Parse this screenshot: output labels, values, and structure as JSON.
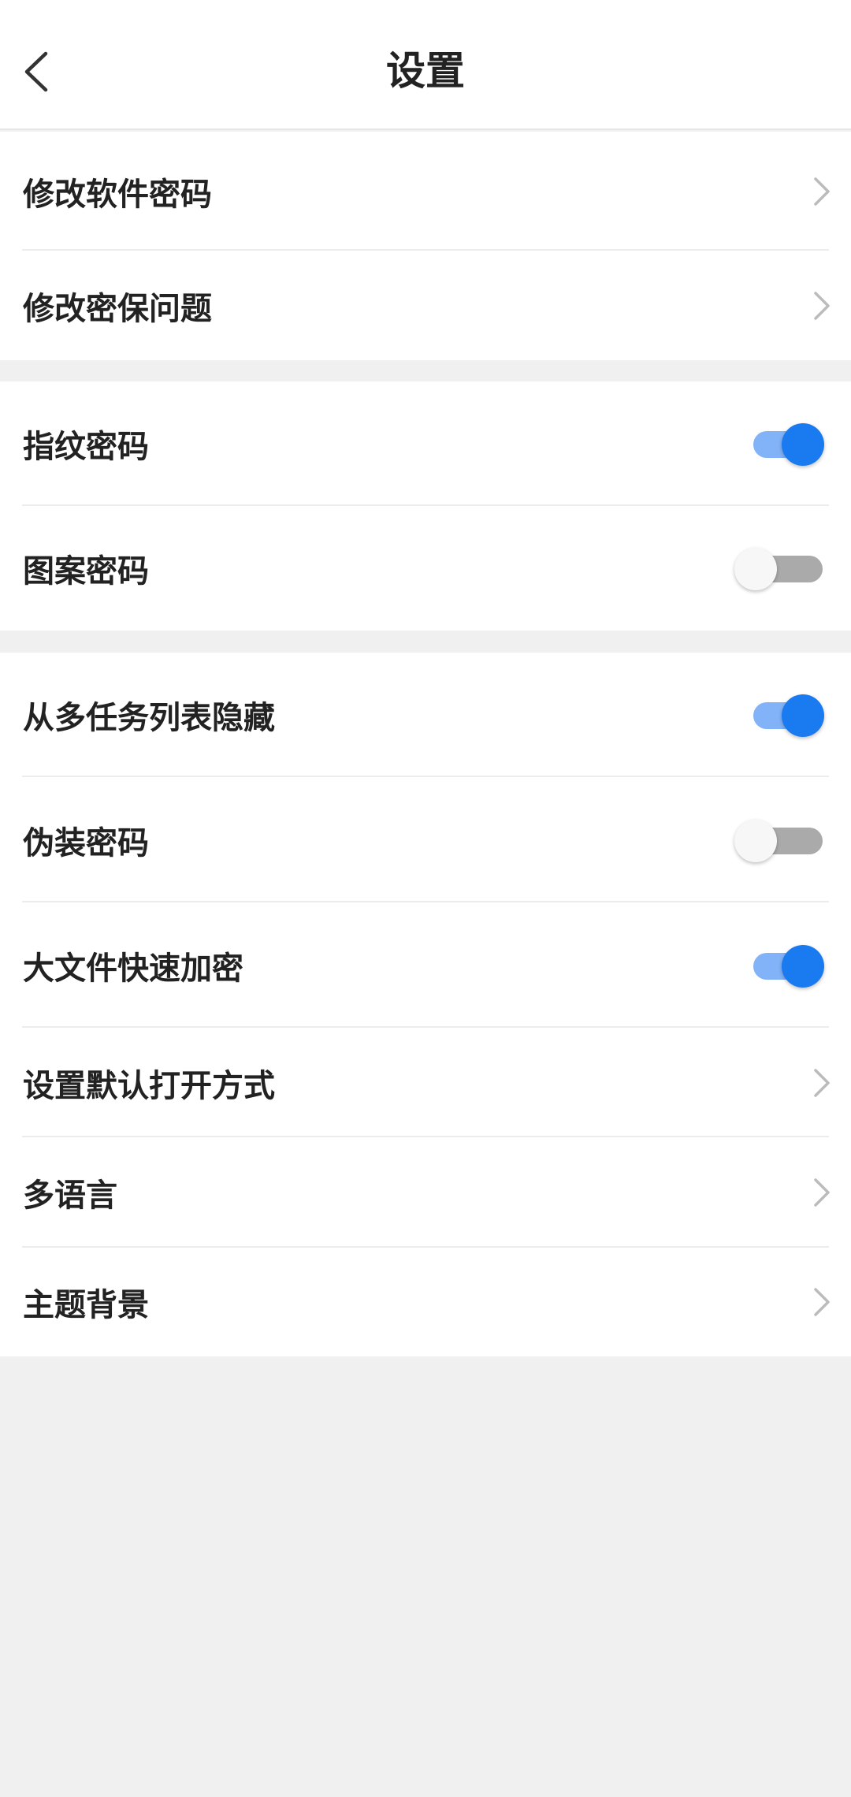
{
  "header": {
    "title": "设置",
    "back_icon": "chevron-left-icon"
  },
  "group1": {
    "items": [
      {
        "label": "修改软件密码",
        "control": "chevron"
      },
      {
        "label": "修改密保问题",
        "control": "chevron"
      }
    ]
  },
  "group2": {
    "items": [
      {
        "label": "指纹密码",
        "control": "toggle",
        "enabled": true
      },
      {
        "label": "图案密码",
        "control": "toggle",
        "enabled": false
      }
    ]
  },
  "group3": {
    "items": [
      {
        "label": "从多任务列表隐藏",
        "control": "toggle",
        "enabled": true
      },
      {
        "label": "伪装密码",
        "control": "toggle",
        "enabled": false
      },
      {
        "label": "大文件快速加密",
        "control": "toggle",
        "enabled": true
      },
      {
        "label": "设置默认打开方式",
        "control": "chevron"
      },
      {
        "label": "多语言",
        "control": "chevron"
      },
      {
        "label": "主题背景",
        "control": "chevron"
      }
    ]
  },
  "colors": {
    "accent": "#1a7af0",
    "accent_track": "#82b2f8",
    "off_track": "#aaaaaa",
    "background": "#f0f0f0",
    "surface": "#ffffff"
  }
}
